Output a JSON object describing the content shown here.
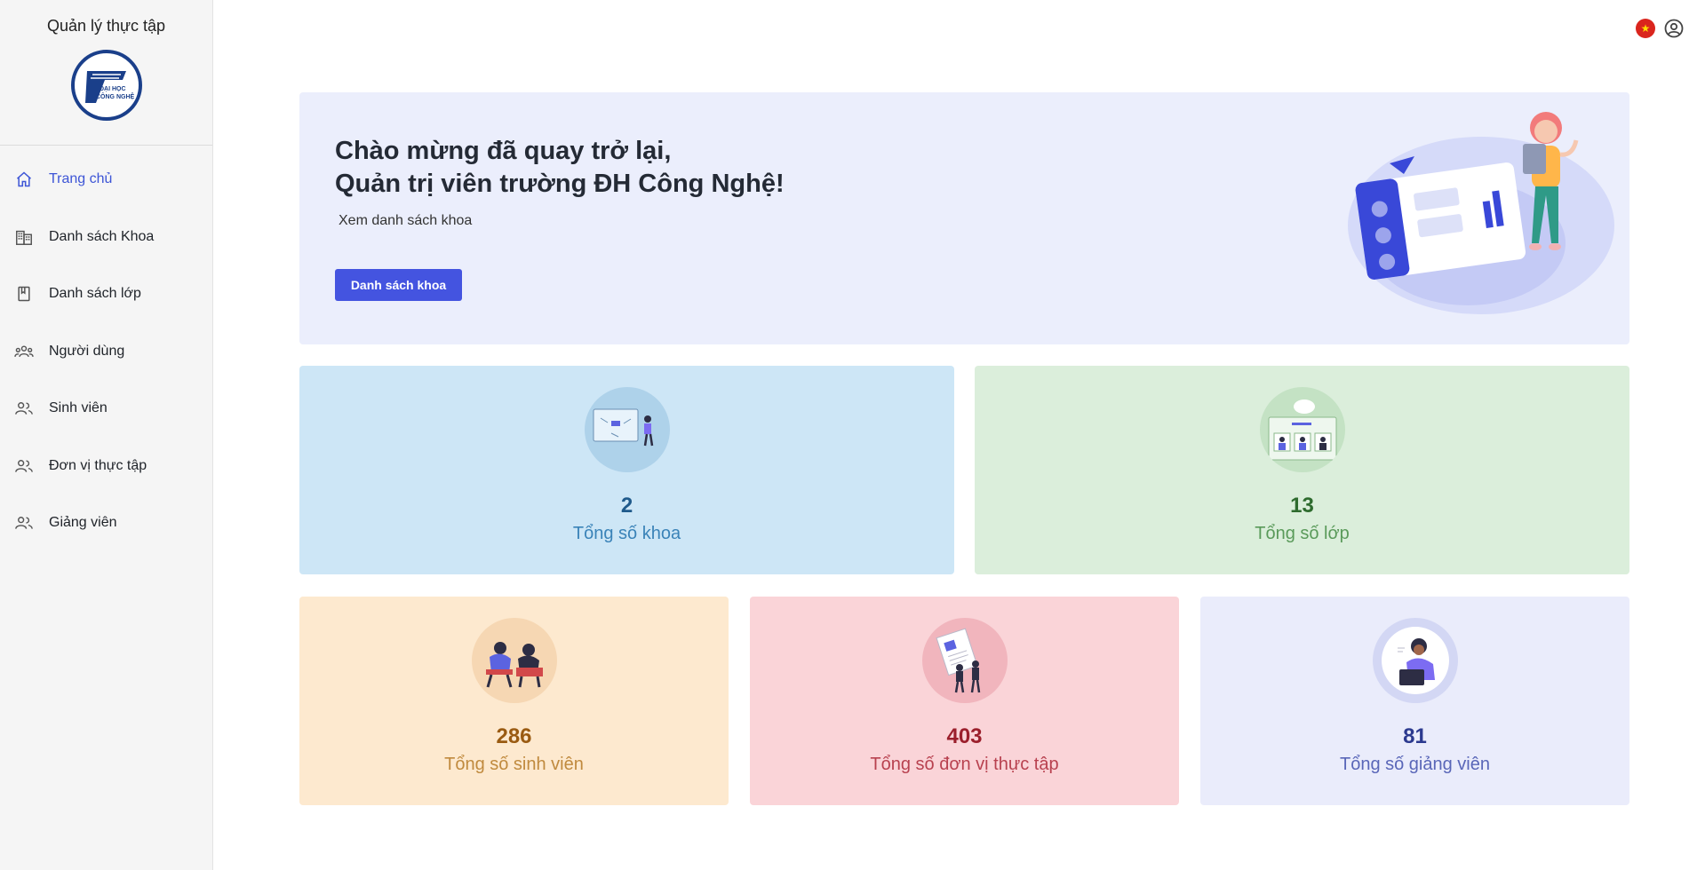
{
  "sidebar": {
    "app_title": "Quản lý thực tập",
    "logo_text": [
      "ĐẠI HỌC",
      "CÔNG NGHỆ"
    ],
    "items": [
      {
        "label": "Trang chủ",
        "icon": "home-icon",
        "active": true
      },
      {
        "label": "Danh sách Khoa",
        "icon": "building-icon",
        "active": false
      },
      {
        "label": "Danh sách lớp",
        "icon": "book-icon",
        "active": false
      },
      {
        "label": "Người dùng",
        "icon": "users-group-icon",
        "active": false
      },
      {
        "label": "Sinh viên",
        "icon": "people-icon",
        "active": false
      },
      {
        "label": "Đơn vị thực tập",
        "icon": "people-icon",
        "active": false
      },
      {
        "label": "Giảng viên",
        "icon": "people-icon",
        "active": false
      }
    ]
  },
  "topbar": {
    "language_icon": "vietnam-flag-icon",
    "account_icon": "user-circle-icon"
  },
  "banner": {
    "line1": "Chào mừng đã quay trở lại,",
    "line2": "Quản trị viên trường ĐH Công Nghệ!",
    "subtitle": "Xem danh sách khoa",
    "button_label": "Danh sách khoa"
  },
  "stats": {
    "khoa": {
      "value": "2",
      "label": "Tổng số khoa"
    },
    "lop": {
      "value": "13",
      "label": "Tổng số lớp"
    },
    "sinh_vien": {
      "value": "286",
      "label": "Tổng số sinh viên"
    },
    "don_vi": {
      "value": "403",
      "label": "Tổng số đơn vị thực tập"
    },
    "giang_vien": {
      "value": "81",
      "label": "Tổng số giảng viên"
    }
  },
  "colors": {
    "accent": "#3d55d6",
    "button": "#4454e0",
    "banner_bg": "#ebeefc"
  }
}
